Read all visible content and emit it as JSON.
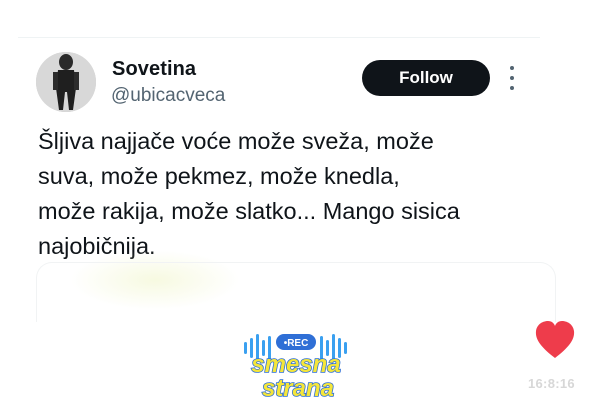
{
  "tweet": {
    "author": {
      "display_name": "Sovetina",
      "handle": "@ubicacveca",
      "avatar_icon": "profile-photo"
    },
    "follow_label": "Follow",
    "more_icon": "more-vertical-icon",
    "text_lines": [
      "Šljiva najjače voće može sveža, može",
      "suva, može pekmez, može knedla,",
      "može rakija, može slatko... Mango sisica",
      "najobičnija."
    ]
  },
  "overlay": {
    "heart_icon": "heart-icon",
    "heart_color": "#ee3c4b",
    "logo": {
      "badge": "•REC",
      "line1": "smesna",
      "line2": "strana",
      "text_color": "#f5e63a",
      "outline_color": "#2f6fd6",
      "bars_color": "#3aa0f0"
    },
    "timestamp": "16:8:16"
  },
  "colors": {
    "text_primary": "#0f1419",
    "text_secondary": "#536471",
    "follow_bg": "#0f1419",
    "follow_text": "#ffffff"
  }
}
